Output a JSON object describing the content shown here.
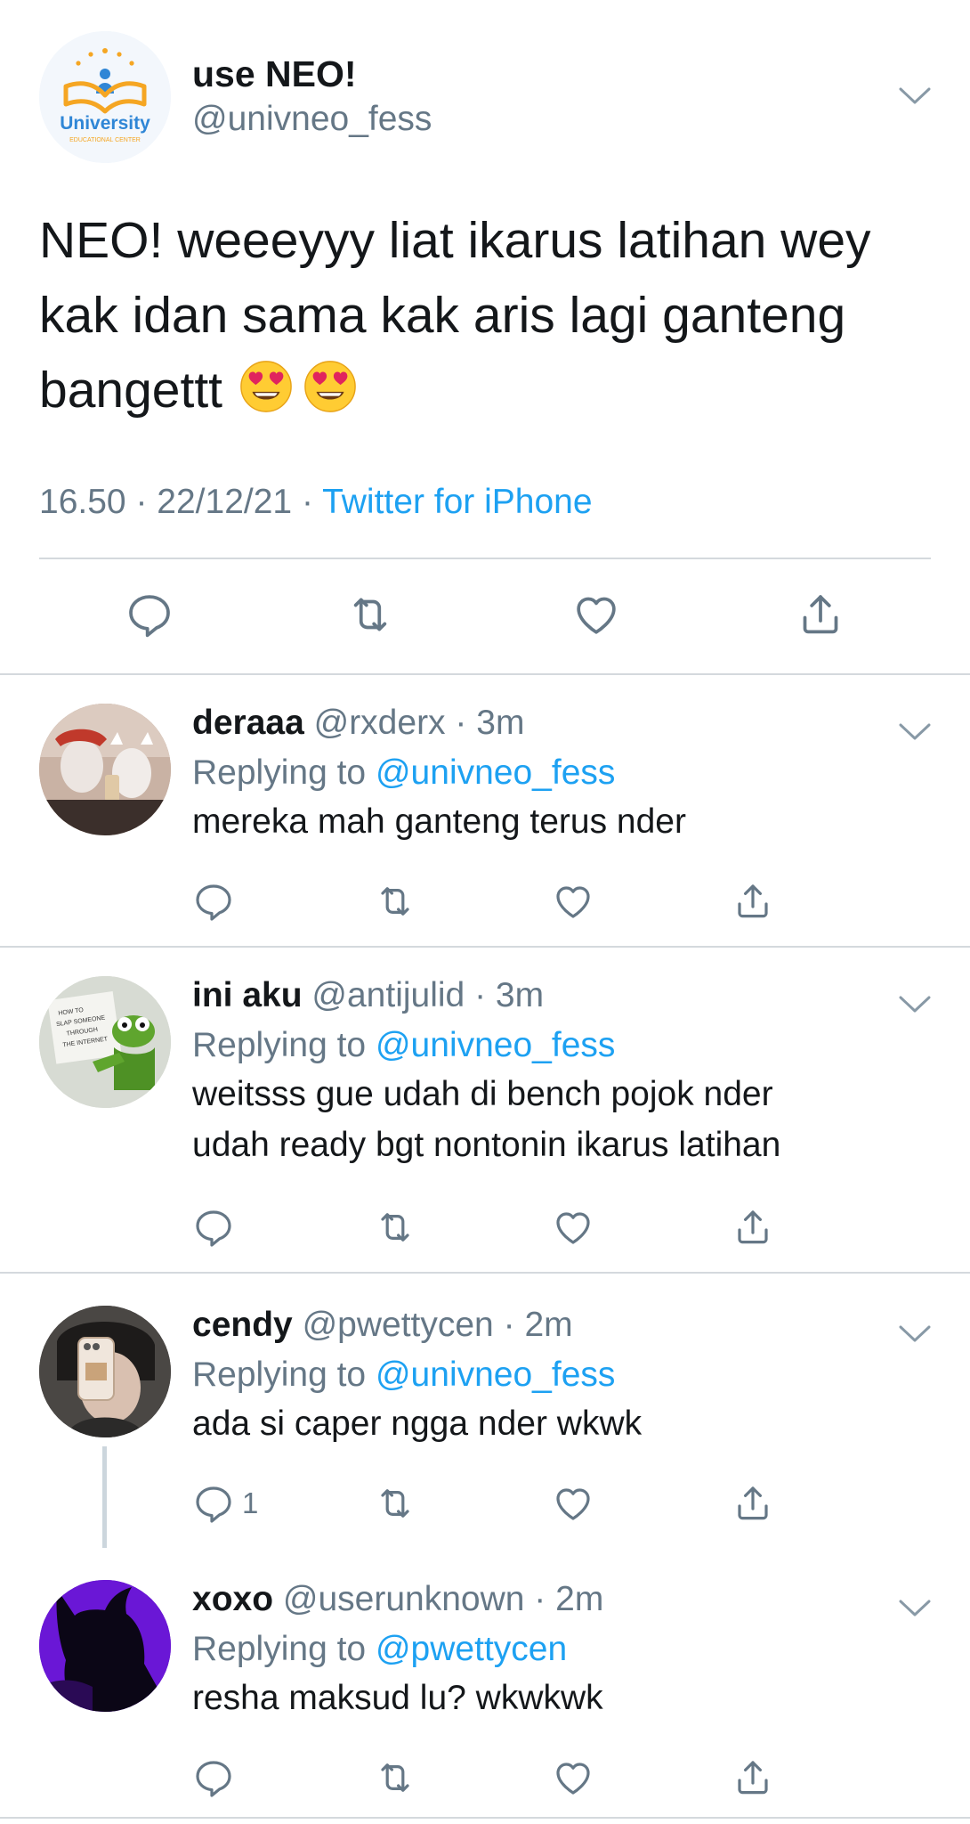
{
  "main_tweet": {
    "name": "use NEO!",
    "handle": "@univneo_fess",
    "avatar": {
      "logo_text": "University",
      "sub_text": "EDUCATIONAL CENTER"
    },
    "body_lines": [
      "NEO! weeeyyy liat ikarus latihan wey",
      "kak idan sama kak aris lagi ganteng",
      "bangettt"
    ],
    "emojis": [
      "smiling-face-with-heart-eyes",
      "smiling-face-with-heart-eyes"
    ],
    "time": "16.50",
    "date": "22/12/21",
    "source": "Twitter for iPhone",
    "sep": "·"
  },
  "replies": [
    {
      "name": "deraaa",
      "handle": "@rxderx",
      "time": "3m",
      "replying_prefix": "Replying to",
      "replying_to": "@univneo_fess",
      "lines": [
        "mereka mah ganteng terus nder"
      ],
      "reply_count": ""
    },
    {
      "name": "ini aku",
      "handle": "@antijulid",
      "time": "3m",
      "replying_prefix": "Replying to",
      "replying_to": "@univneo_fess",
      "lines": [
        "weitsss gue udah di bench pojok nder",
        "udah ready bgt nontonin ikarus latihan"
      ],
      "reply_count": ""
    },
    {
      "name": "cendy",
      "handle": "@pwettycen",
      "time": "2m",
      "replying_prefix": "Replying to",
      "replying_to": "@univneo_fess",
      "lines": [
        "ada si caper ngga nder wkwk"
      ],
      "reply_count": "1"
    },
    {
      "name": "xoxo",
      "handle": "@userunknown",
      "time": "2m",
      "replying_prefix": "Replying to",
      "replying_to": "@pwettycen",
      "lines": [
        "resha maksud lu? wkwkwk"
      ],
      "reply_count": ""
    }
  ],
  "avatar_sign_text": [
    "HOW TO",
    "SLAP SOMEONE",
    "THROUGH",
    "THE INTERNET"
  ],
  "colors": {
    "text": "#14171a",
    "secondary": "#657786",
    "link": "#1da1f2",
    "divider": "#d4d9dd"
  }
}
